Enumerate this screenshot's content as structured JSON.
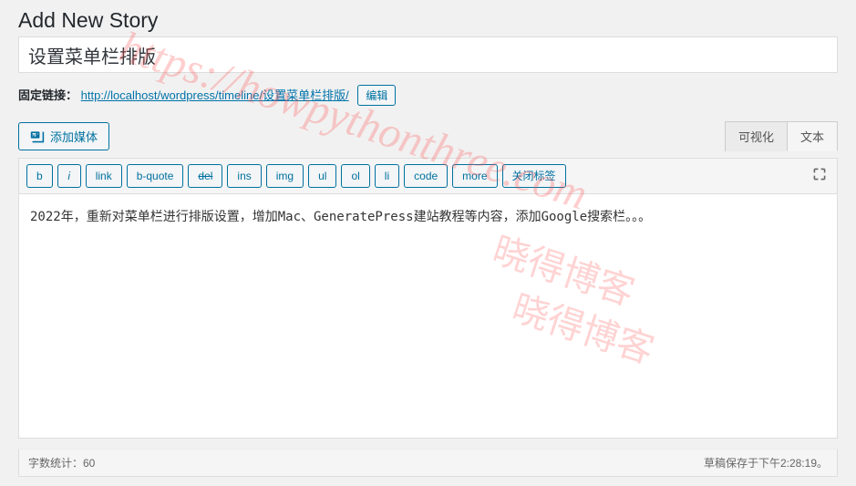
{
  "heading": "Add New Story",
  "title_value": "设置菜单栏排版",
  "permalink": {
    "label": "固定链接：",
    "base_url": "http://localhost/wordpress/timeline/",
    "slug": "设置菜单栏排版/",
    "edit_btn": "编辑"
  },
  "media_button": "添加媒体",
  "tabs": {
    "visual": "可视化",
    "text": "文本"
  },
  "toolbar": {
    "b": "b",
    "i": "i",
    "link": "link",
    "bquote": "b-quote",
    "del": "del",
    "ins": "ins",
    "img": "img",
    "ul": "ul",
    "ol": "ol",
    "li": "li",
    "code": "code",
    "more": "more",
    "close": "关闭标签"
  },
  "content": "2022年，重新对菜单栏进行排版设置，增加Mac、GeneratePress建站教程等内容，添加Google搜索栏。。。",
  "status": {
    "word_count": "字数统计：60",
    "draft_saved": "草稿保存于下午2:28:19。"
  },
  "watermarks": {
    "w1": "https://howpythonthree.com",
    "w2a": "晓得博客",
    "w2b": "晓得博客"
  }
}
